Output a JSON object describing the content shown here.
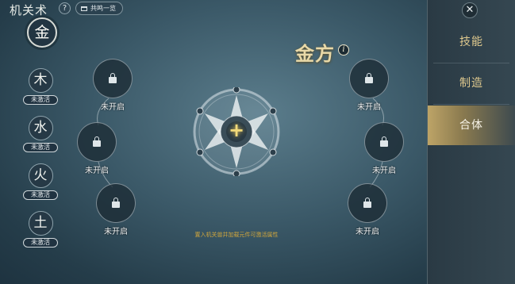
{
  "header": {
    "title": "机关术",
    "help_icon": "?",
    "guide_label": "共鸣一览"
  },
  "elements": {
    "selected": "金",
    "items": [
      {
        "glyph": "木",
        "status": "未激活"
      },
      {
        "glyph": "水",
        "status": "未激活"
      },
      {
        "glyph": "火",
        "status": "未激活"
      },
      {
        "glyph": "土",
        "status": "未激活"
      }
    ]
  },
  "section": {
    "name": "金方",
    "info_icon": "i"
  },
  "slots": {
    "locked_label": "未开启"
  },
  "center": {
    "plus": "+",
    "caption": "置入机关兽并加载元件可激活属性"
  },
  "tabs": [
    {
      "label": "技能",
      "selected": false
    },
    {
      "label": "制造",
      "selected": false
    },
    {
      "label": "合体",
      "selected": true
    }
  ],
  "close_icon": "✕",
  "colors": {
    "gold": "#d1a63c",
    "accent": "#e9d9a8",
    "tab_text": "#dfc98e"
  }
}
